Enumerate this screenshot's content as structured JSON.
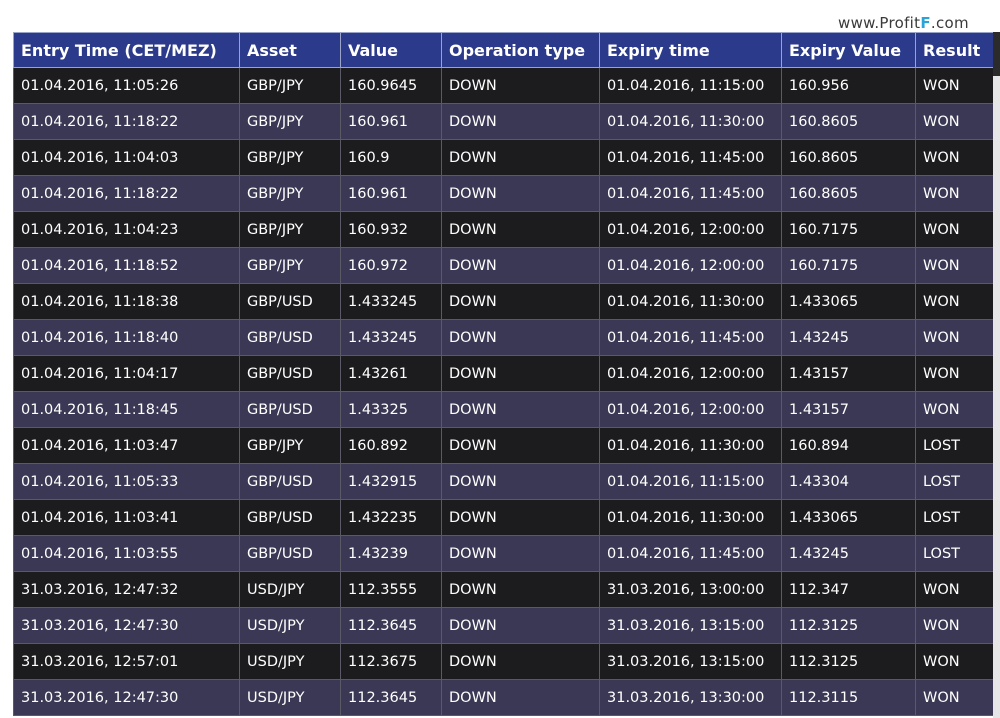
{
  "watermark": {
    "prefix": "www.Profit",
    "accent": "F",
    "suffix": ".com"
  },
  "table": {
    "headers": [
      "Entry Time (CET/MEZ)",
      "Asset",
      "Value",
      "Operation type",
      "Expiry time",
      "Expiry Value",
      "Result"
    ],
    "rows": [
      [
        "01.04.2016, 11:05:26",
        "GBP/JPY",
        "160.9645",
        "DOWN",
        "01.04.2016, 11:15:00",
        "160.956",
        "WON"
      ],
      [
        "01.04.2016, 11:18:22",
        "GBP/JPY",
        "160.961",
        "DOWN",
        "01.04.2016, 11:30:00",
        "160.8605",
        "WON"
      ],
      [
        "01.04.2016, 11:04:03",
        "GBP/JPY",
        "160.9",
        "DOWN",
        "01.04.2016, 11:45:00",
        "160.8605",
        "WON"
      ],
      [
        "01.04.2016, 11:18:22",
        "GBP/JPY",
        "160.961",
        "DOWN",
        "01.04.2016, 11:45:00",
        "160.8605",
        "WON"
      ],
      [
        "01.04.2016, 11:04:23",
        "GBP/JPY",
        "160.932",
        "DOWN",
        "01.04.2016, 12:00:00",
        "160.7175",
        "WON"
      ],
      [
        "01.04.2016, 11:18:52",
        "GBP/JPY",
        "160.972",
        "DOWN",
        "01.04.2016, 12:00:00",
        "160.7175",
        "WON"
      ],
      [
        "01.04.2016, 11:18:38",
        "GBP/USD",
        "1.433245",
        "DOWN",
        "01.04.2016, 11:30:00",
        "1.433065",
        "WON"
      ],
      [
        "01.04.2016, 11:18:40",
        "GBP/USD",
        "1.433245",
        "DOWN",
        "01.04.2016, 11:45:00",
        "1.43245",
        "WON"
      ],
      [
        "01.04.2016, 11:04:17",
        "GBP/USD",
        "1.43261",
        "DOWN",
        "01.04.2016, 12:00:00",
        "1.43157",
        "WON"
      ],
      [
        "01.04.2016, 11:18:45",
        "GBP/USD",
        "1.43325",
        "DOWN",
        "01.04.2016, 12:00:00",
        "1.43157",
        "WON"
      ],
      [
        "01.04.2016, 11:03:47",
        "GBP/JPY",
        "160.892",
        "DOWN",
        "01.04.2016, 11:30:00",
        "160.894",
        "LOST"
      ],
      [
        "01.04.2016, 11:05:33",
        "GBP/USD",
        "1.432915",
        "DOWN",
        "01.04.2016, 11:15:00",
        "1.43304",
        "LOST"
      ],
      [
        "01.04.2016, 11:03:41",
        "GBP/USD",
        "1.432235",
        "DOWN",
        "01.04.2016, 11:30:00",
        "1.433065",
        "LOST"
      ],
      [
        "01.04.2016, 11:03:55",
        "GBP/USD",
        "1.43239",
        "DOWN",
        "01.04.2016, 11:45:00",
        "1.43245",
        "LOST"
      ],
      [
        "31.03.2016, 12:47:32",
        "USD/JPY",
        "112.3555",
        "DOWN",
        "31.03.2016, 13:00:00",
        "112.347",
        "WON"
      ],
      [
        "31.03.2016, 12:47:30",
        "USD/JPY",
        "112.3645",
        "DOWN",
        "31.03.2016, 13:15:00",
        "112.3125",
        "WON"
      ],
      [
        "31.03.2016, 12:57:01",
        "USD/JPY",
        "112.3675",
        "DOWN",
        "31.03.2016, 13:15:00",
        "112.3125",
        "WON"
      ],
      [
        "31.03.2016, 12:47:30",
        "USD/JPY",
        "112.3645",
        "DOWN",
        "31.03.2016, 13:30:00",
        "112.3115",
        "WON"
      ]
    ]
  },
  "colors": {
    "header_bg": "#2b3a8a",
    "row_dark": "#1c1c1e",
    "row_alt": "#3a3854",
    "text": "#ffffff"
  }
}
